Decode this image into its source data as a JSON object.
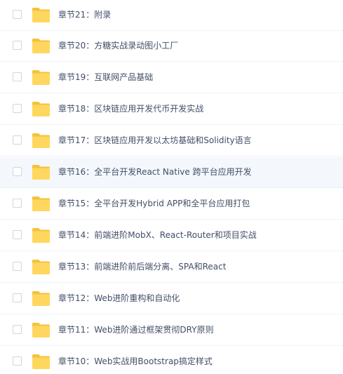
{
  "folder_color": "#ffd75e",
  "folder_tab_color": "#f5c23c",
  "items": [
    {
      "name": "章节21：附录",
      "icon": "folder-icon"
    },
    {
      "name": "章节20：方糖实战录动图小工厂",
      "icon": "folder-icon"
    },
    {
      "name": "章节19：互联网产品基础",
      "icon": "folder-icon"
    },
    {
      "name": "章节18：区块链应用开发代币开发实战",
      "icon": "folder-icon"
    },
    {
      "name": "章节17：区块链应用开发以太坊基础和Solidity语言",
      "icon": "folder-icon"
    },
    {
      "name": "章节16：全平台开发React Native 跨平台应用开发",
      "icon": "folder-icon"
    },
    {
      "name": "章节15：全平台开发Hybrid APP和全平台应用打包",
      "icon": "folder-icon"
    },
    {
      "name": "章节14：前端进阶MobX、React-Router和项目实战",
      "icon": "folder-icon"
    },
    {
      "name": "章节13：前端进阶前后端分离、SPA和React",
      "icon": "folder-icon"
    },
    {
      "name": "章节12：Web进阶重构和自动化",
      "icon": "folder-icon"
    },
    {
      "name": "章节11：Web进阶通过框架贯彻DRY原则",
      "icon": "folder-icon"
    },
    {
      "name": "章节10：Web实战用Bootstrap搞定样式",
      "icon": "folder-icon"
    }
  ]
}
